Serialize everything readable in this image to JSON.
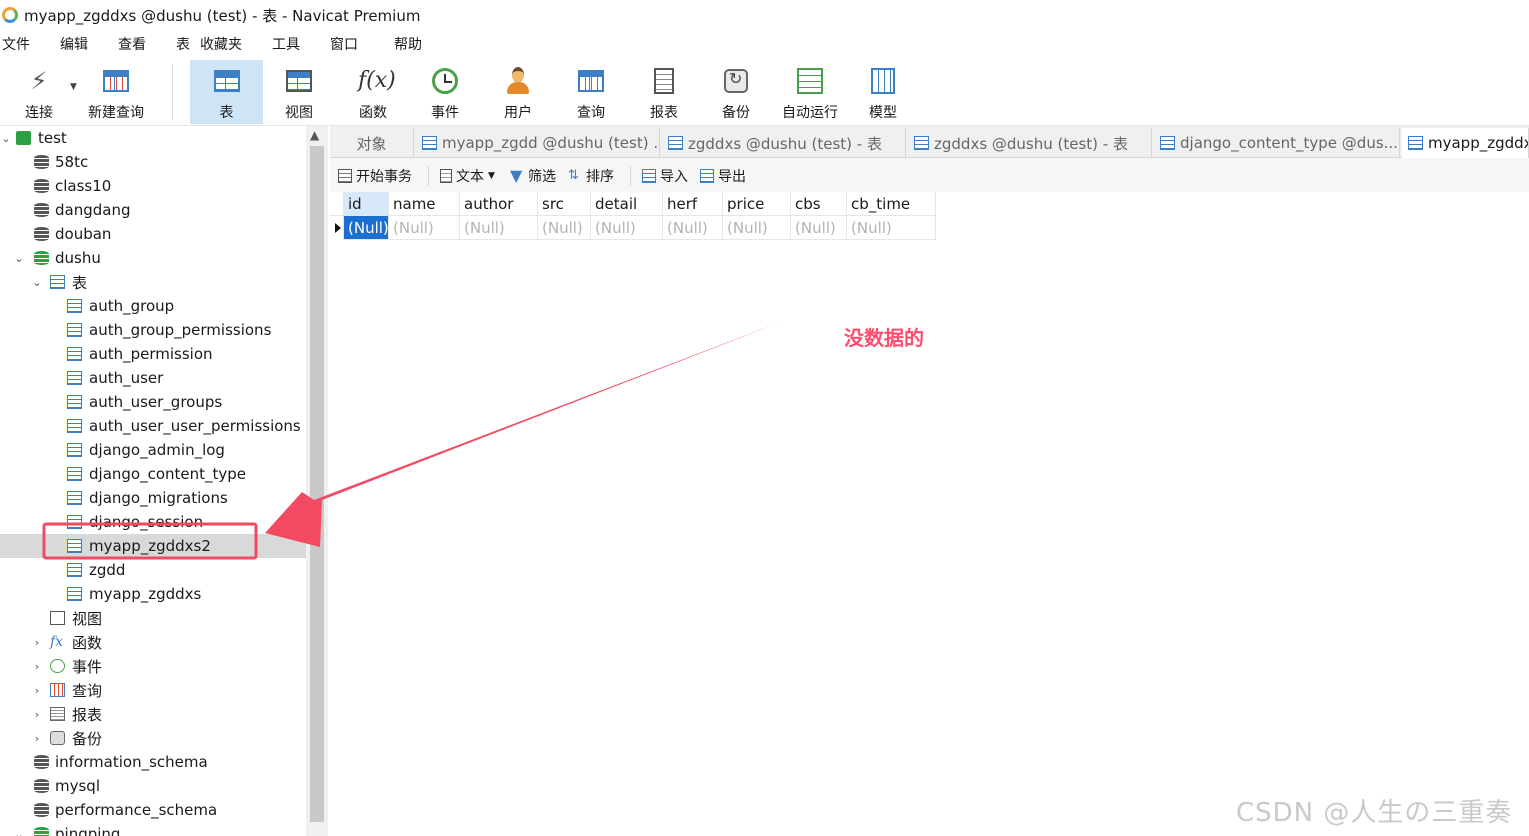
{
  "window": {
    "title": "myapp_zgddxs @dushu (test) - 表 - Navicat Premium"
  },
  "menu": [
    "文件",
    "编辑",
    "查看",
    "表",
    "收藏夹",
    "工具",
    "窗口",
    "帮助"
  ],
  "toolbar": {
    "connect": "连接",
    "new_query": "新建查询",
    "table": "表",
    "view": "视图",
    "function": "函数",
    "event": "事件",
    "user": "用户",
    "query": "查询",
    "report": "报表",
    "backup": "备份",
    "auto_run": "自动运行",
    "model": "模型"
  },
  "sidebar": {
    "connection": "test",
    "databases_top": [
      "58tc",
      "class10",
      "dangdang",
      "douban"
    ],
    "open_db": "dushu",
    "tables_group": "表",
    "tables": [
      "auth_group",
      "auth_group_permissions",
      "auth_permission",
      "auth_user",
      "auth_user_groups",
      "auth_user_user_permissions",
      "django_admin_log",
      "django_content_type",
      "django_migrations",
      "django_session",
      "myapp_zgddxs2",
      "zgdd",
      "myapp_zgddxs"
    ],
    "selected_table": "myapp_zgddxs2",
    "groups": [
      "视图",
      "函数",
      "事件",
      "查询",
      "报表",
      "备份"
    ],
    "databases_bottom": [
      "information_schema",
      "mysql",
      "performance_schema",
      "pingping"
    ]
  },
  "tabs": [
    {
      "label": "对象"
    },
    {
      "label": "myapp_zgdd @dushu (test) ..."
    },
    {
      "label": "zgddxs @dushu (test) - 表"
    },
    {
      "label": "zgddxs @dushu (test) - 表"
    },
    {
      "label": "django_content_type @dus..."
    },
    {
      "label": "myapp_zgddx"
    }
  ],
  "object_toolbar": {
    "begin_transaction": "开始事务",
    "text": "文本",
    "filter": "筛选",
    "sort": "排序",
    "import": "导入",
    "export": "导出"
  },
  "grid": {
    "columns": [
      "id",
      "name",
      "author",
      "src",
      "detail",
      "herf",
      "price",
      "cbs",
      "cb_time"
    ],
    "rows": [
      [
        "(Null)",
        "(Null)",
        "(Null)",
        "(Null)",
        "(Null)",
        "(Null)",
        "(Null)",
        "(Null)",
        "(Null)"
      ]
    ]
  },
  "annotation": {
    "text": "没数据的",
    "color": "#ff4d6d"
  },
  "watermark": "CSDN @人生の三重奏"
}
